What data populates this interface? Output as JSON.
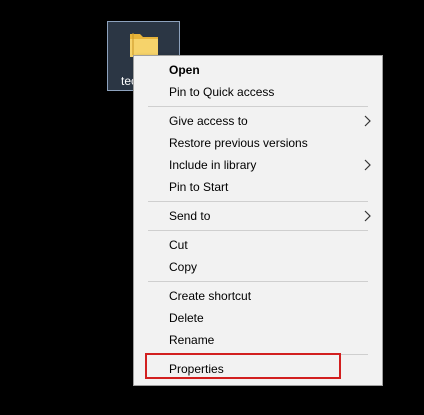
{
  "desktop": {
    "icon": {
      "icon_name": "folder-icon",
      "label": "tec"
    }
  },
  "context_menu": {
    "groups": [
      [
        {
          "label": "Open",
          "bold": true,
          "submenu": false
        },
        {
          "label": "Pin to Quick access",
          "bold": false,
          "submenu": false
        }
      ],
      [
        {
          "label": "Give access to",
          "bold": false,
          "submenu": true
        },
        {
          "label": "Restore previous versions",
          "bold": false,
          "submenu": false
        },
        {
          "label": "Include in library",
          "bold": false,
          "submenu": true
        },
        {
          "label": "Pin to Start",
          "bold": false,
          "submenu": false
        }
      ],
      [
        {
          "label": "Send to",
          "bold": false,
          "submenu": true
        }
      ],
      [
        {
          "label": "Cut",
          "bold": false,
          "submenu": false
        },
        {
          "label": "Copy",
          "bold": false,
          "submenu": false
        }
      ],
      [
        {
          "label": "Create shortcut",
          "bold": false,
          "submenu": false
        },
        {
          "label": "Delete",
          "bold": false,
          "submenu": false
        },
        {
          "label": "Rename",
          "bold": false,
          "submenu": false
        }
      ],
      [
        {
          "label": "Properties",
          "bold": false,
          "submenu": false,
          "highlighted": true
        }
      ]
    ],
    "submenu_icon": "chevron-right-icon",
    "highlight_color": "#d21f1f"
  }
}
